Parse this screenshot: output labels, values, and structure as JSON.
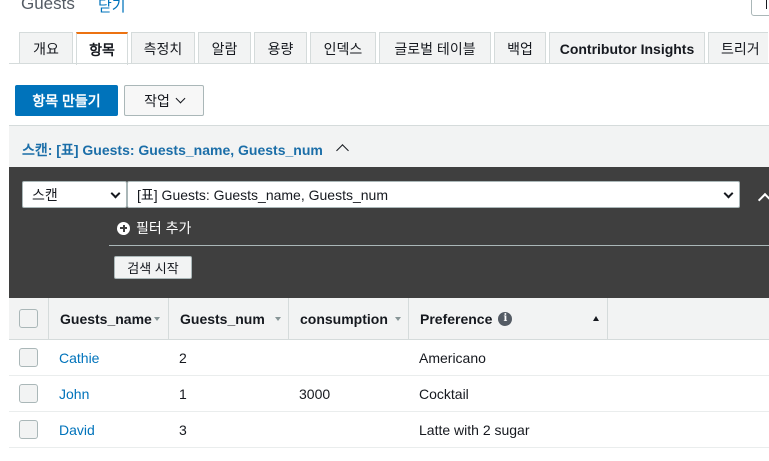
{
  "header": {
    "title": "Guests",
    "close_label": "닫기"
  },
  "tabs": [
    {
      "label": "개요"
    },
    {
      "label": "항목",
      "active": true
    },
    {
      "label": "측정치"
    },
    {
      "label": "알람"
    },
    {
      "label": "용량"
    },
    {
      "label": "인덱스"
    },
    {
      "label": "글로벌 테이블"
    },
    {
      "label": "백업"
    },
    {
      "label": "Contributor Insights"
    },
    {
      "label": "트리거"
    }
  ],
  "actions": {
    "create_item": "항목 만들기",
    "actions_menu": "작업"
  },
  "scan_header": {
    "title": "스캔: [표] Guests: Guests_name, Guests_num"
  },
  "filter_panel": {
    "mode_value": "스캔",
    "index_value": "[표] Guests: Guests_name, Guests_num",
    "add_filter": "필터 추가",
    "start_search": "검색 시작"
  },
  "table": {
    "columns": [
      "Guests_name",
      "Guests_num",
      "consumption",
      "Preference"
    ],
    "rows": [
      {
        "Guests_name": "Cathie",
        "Guests_num": "2",
        "consumption": "",
        "Preference": "Americano"
      },
      {
        "Guests_name": "John",
        "Guests_num": "1",
        "consumption": "3000",
        "Preference": "Cocktail"
      },
      {
        "Guests_name": "David",
        "Guests_num": "3",
        "consumption": "",
        "Preference": "Latte with 2 sugar"
      }
    ]
  },
  "icons": {
    "add_filter": "plus-circle-icon",
    "info": "info-icon",
    "collapse": "chevron-up-icon",
    "dropdown": "chevron-down-icon"
  },
  "colors": {
    "primary": "#0073bb",
    "tab_accent": "#ec7211",
    "dark_panel": "#3f3f3f",
    "link": "#0073bb"
  }
}
